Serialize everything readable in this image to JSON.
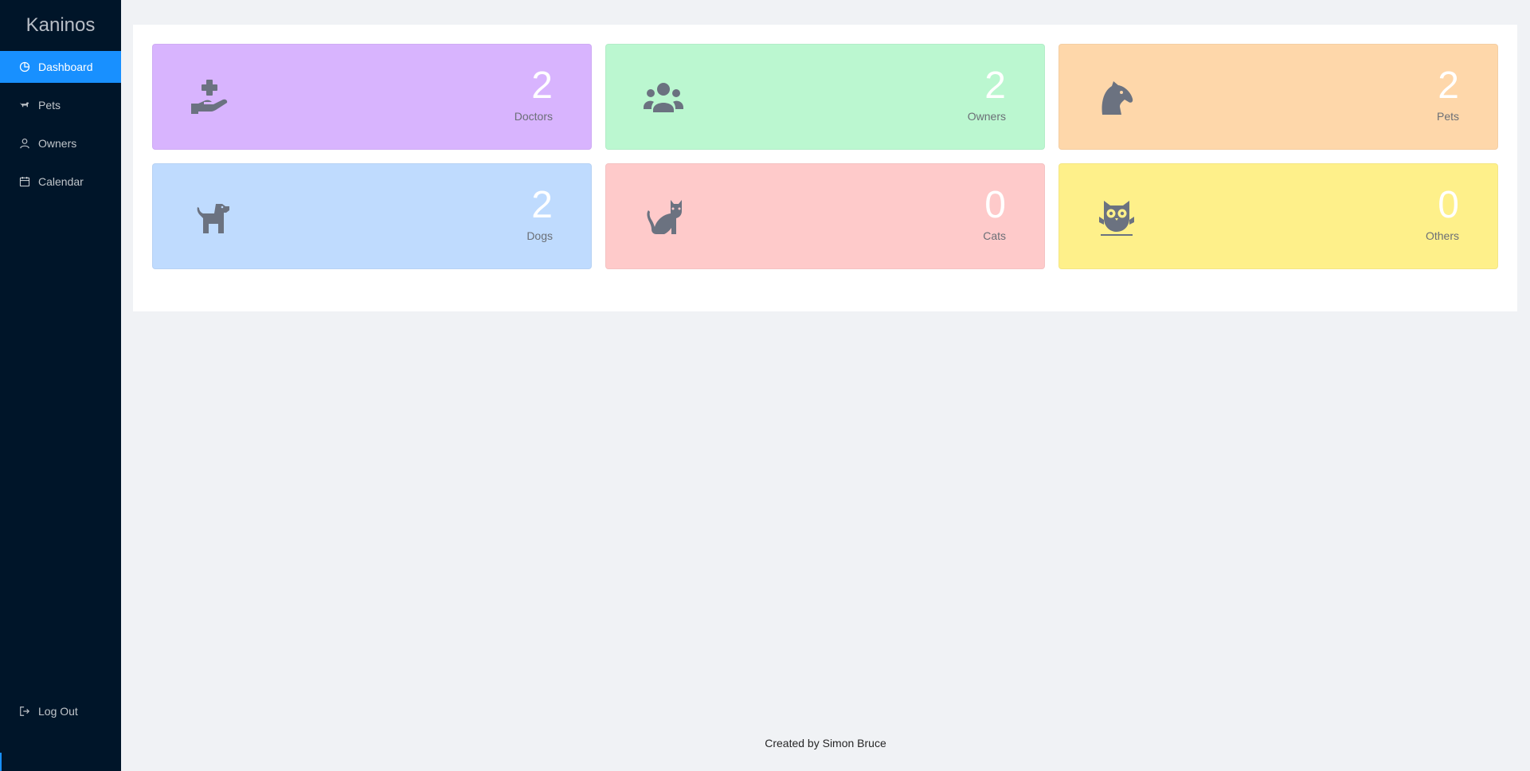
{
  "app": {
    "title": "Kaninos"
  },
  "sidebar": {
    "items": [
      {
        "label": "Dashboard",
        "icon": "dashboard-icon",
        "active": true
      },
      {
        "label": "Pets",
        "icon": "dog-icon",
        "active": false
      },
      {
        "label": "Owners",
        "icon": "user-icon",
        "active": false
      },
      {
        "label": "Calendar",
        "icon": "calendar-icon",
        "active": false
      }
    ],
    "logout": {
      "label": "Log Out",
      "icon": "logout-icon"
    }
  },
  "stats": [
    {
      "value": "2",
      "label": "Doctors",
      "icon": "hand-holding-medical-icon",
      "color": "#d8b4fe"
    },
    {
      "value": "2",
      "label": "Owners",
      "icon": "users-group-icon",
      "color": "#bbf7d0"
    },
    {
      "value": "2",
      "label": "Pets",
      "icon": "horse-head-icon",
      "color": "#fed7aa"
    },
    {
      "value": "2",
      "label": "Dogs",
      "icon": "dog-icon",
      "color": "#bfdbfe"
    },
    {
      "value": "0",
      "label": "Cats",
      "icon": "cat-icon",
      "color": "#fecaca"
    },
    {
      "value": "0",
      "label": "Others",
      "icon": "owl-icon",
      "color": "#fef08a"
    }
  ],
  "footer": {
    "text": "Created by Simon Bruce"
  },
  "colors": {
    "sidebar_bg": "#001529",
    "accent": "#1890ff",
    "icon_gray": "#6b7280"
  }
}
